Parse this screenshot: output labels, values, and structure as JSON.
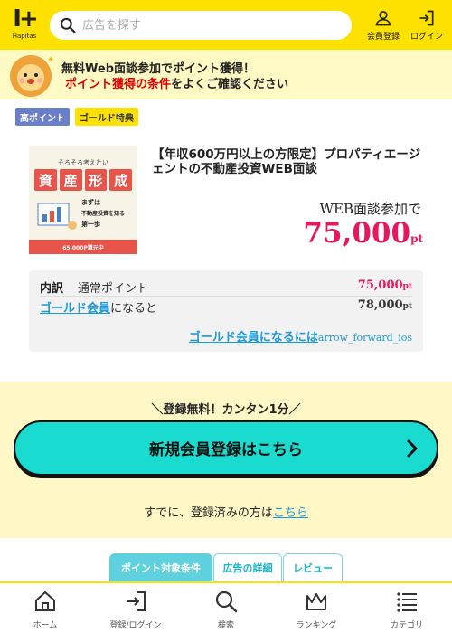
{
  "header": {
    "logo_text": "Hapitas",
    "search_placeholder": "広告を探す",
    "member_label": "会員登録",
    "login_label": "ログイン",
    "brand_color": "#ffe100"
  },
  "banner": {
    "line1": "無料Web面談参加でポイント獲得！",
    "line2_red": "ポイント獲得の条件",
    "line2_rest": "をよくご確認ください"
  },
  "badges": [
    "高ポイント",
    "ゴールド特典"
  ],
  "offer": {
    "thumb_line1": "そろそろ考えたい",
    "thumb_big": [
      "資",
      "産",
      "形",
      "成"
    ],
    "thumb_line2": "まずは",
    "thumb_line3": "不動産投資を知る",
    "thumb_line4": "第一歩",
    "thumb_footer": "65,000P還元中",
    "title": "【年収600万円以上の方限定】プロパティエージェントの不動産投資WEB面談",
    "condition": "WEB面談参加で",
    "points": "75,000",
    "unit": "pt"
  },
  "breakdown": {
    "label": "内訳",
    "normal_label": "通常ポイント",
    "normal_value": "75,000",
    "gold_link": "ゴールド会員",
    "gold_suffix": "になると",
    "gold_value": "78,000",
    "unit": "pt",
    "gold_how_link": "ゴールド会員になるには",
    "gold_how_icon": "arrow_forward_ios"
  },
  "register": {
    "catch": "＼登録無料！カンタン1分／",
    "button": "新規会員登録はこちら",
    "login_text": "すでに、登録済みの方は",
    "login_link": "こちら",
    "button_color": "#19dbd0"
  },
  "tabs": [
    "ポイント対象条件",
    "広告の詳細",
    "レビュー"
  ],
  "bottom_nav": [
    "ホーム",
    "登録/ログイン",
    "検索",
    "ランキング",
    "カテゴリ"
  ]
}
